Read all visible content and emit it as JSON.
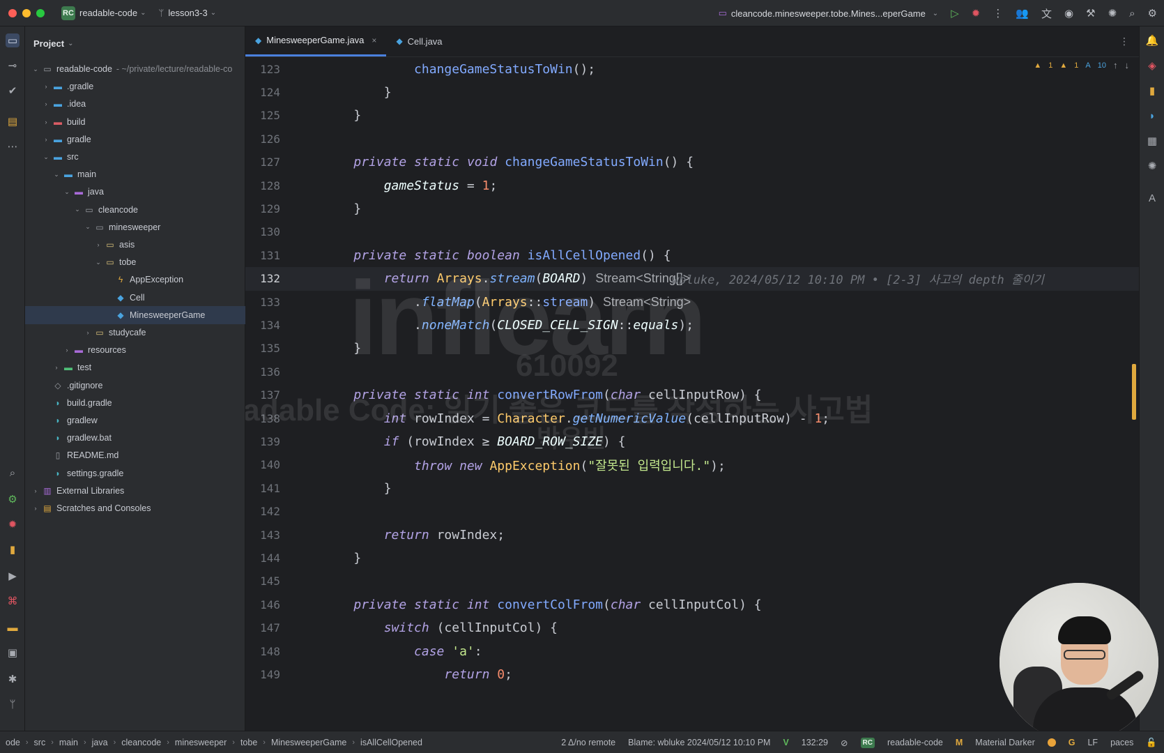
{
  "titlebar": {
    "project_badge": "RC",
    "project_name": "readable-code",
    "branch": "lesson3-3",
    "run_config": "cleancode.minesweeper.tobe.Mines...eperGame"
  },
  "project_panel": {
    "title": "Project",
    "tree": [
      {
        "label": "readable-code",
        "hint": "- ~/private/lecture/readable-co",
        "depth": 0,
        "arrow": "open",
        "icon": "module-folder-icon"
      },
      {
        "label": ".gradle",
        "depth": 1,
        "arrow": "closed",
        "icon": "folder-icon"
      },
      {
        "label": ".idea",
        "depth": 1,
        "arrow": "closed",
        "icon": "folder-icon"
      },
      {
        "label": "build",
        "depth": 1,
        "arrow": "closed",
        "icon": "folder-excluded-icon"
      },
      {
        "label": "gradle",
        "depth": 1,
        "arrow": "closed",
        "icon": "folder-icon"
      },
      {
        "label": "src",
        "depth": 1,
        "arrow": "open",
        "icon": "folder-icon"
      },
      {
        "label": "main",
        "depth": 2,
        "arrow": "open",
        "icon": "folder-icon"
      },
      {
        "label": "java",
        "depth": 3,
        "arrow": "open",
        "icon": "source-folder-icon"
      },
      {
        "label": "cleancode",
        "depth": 4,
        "arrow": "open",
        "icon": "package-icon"
      },
      {
        "label": "minesweeper",
        "depth": 5,
        "arrow": "open",
        "icon": "package-icon"
      },
      {
        "label": "asis",
        "depth": 6,
        "arrow": "closed",
        "icon": "package-icon"
      },
      {
        "label": "tobe",
        "depth": 6,
        "arrow": "open",
        "icon": "package-icon"
      },
      {
        "label": "AppException",
        "depth": 7,
        "arrow": "none",
        "icon": "exception-class-icon"
      },
      {
        "label": "Cell",
        "depth": 7,
        "arrow": "none",
        "icon": "class-icon"
      },
      {
        "label": "MinesweeperGame",
        "depth": 7,
        "arrow": "none",
        "icon": "class-icon",
        "selected": true
      },
      {
        "label": "studycafe",
        "depth": 5,
        "arrow": "closed",
        "icon": "package-icon"
      },
      {
        "label": "resources",
        "depth": 3,
        "arrow": "closed",
        "icon": "resources-folder-icon"
      },
      {
        "label": "test",
        "depth": 2,
        "arrow": "closed",
        "icon": "test-folder-icon"
      },
      {
        "label": ".gitignore",
        "depth": 1,
        "arrow": "none",
        "icon": "gitignore-icon"
      },
      {
        "label": "build.gradle",
        "depth": 1,
        "arrow": "none",
        "icon": "gradle-icon"
      },
      {
        "label": "gradlew",
        "depth": 1,
        "arrow": "none",
        "icon": "gradle-icon"
      },
      {
        "label": "gradlew.bat",
        "depth": 1,
        "arrow": "none",
        "icon": "gradle-icon"
      },
      {
        "label": "README.md",
        "depth": 1,
        "arrow": "none",
        "icon": "markdown-icon"
      },
      {
        "label": "settings.gradle",
        "depth": 1,
        "arrow": "none",
        "icon": "gradle-icon"
      },
      {
        "label": "External Libraries",
        "depth": 0,
        "arrow": "closed",
        "icon": "library-icon"
      },
      {
        "label": "Scratches and Consoles",
        "depth": 0,
        "arrow": "closed",
        "icon": "scratches-icon"
      }
    ]
  },
  "tabs": [
    {
      "label": "MinesweeperGame.java",
      "active": true,
      "closable": true
    },
    {
      "label": "Cell.java",
      "active": false,
      "closable": false
    }
  ],
  "inspections": {
    "warnings_1": "1",
    "warnings_2": "1",
    "typos": "10"
  },
  "editor": {
    "current_line": 132,
    "blame_inline": "wbluke, 2024/05/12 10:10 PM • [2-3] 사고의 depth 줄이기",
    "lines": [
      {
        "n": 123,
        "text": "            changeGameStatusToWin();"
      },
      {
        "n": 124,
        "text": "        }"
      },
      {
        "n": 125,
        "text": "    }"
      },
      {
        "n": 126,
        "text": ""
      },
      {
        "n": 127,
        "text": "    private static void changeGameStatusToWin() {"
      },
      {
        "n": 128,
        "text": "        gameStatus = 1;"
      },
      {
        "n": 129,
        "text": "    }"
      },
      {
        "n": 130,
        "text": ""
      },
      {
        "n": 131,
        "text": "    private static boolean isAllCellOpened() {"
      },
      {
        "n": 132,
        "text": "        return Arrays.stream(BOARD) Stream<String[]>"
      },
      {
        "n": 133,
        "text": "            .flatMap(Arrays::stream) Stream<String>"
      },
      {
        "n": 134,
        "text": "            .noneMatch(CLOSED_CELL_SIGN::equals);"
      },
      {
        "n": 135,
        "text": "    }"
      },
      {
        "n": 136,
        "text": ""
      },
      {
        "n": 137,
        "text": "    private static int convertRowFrom(char cellInputRow) {"
      },
      {
        "n": 138,
        "text": "        int rowIndex = Character.getNumericValue(cellInputRow) - 1;"
      },
      {
        "n": 139,
        "text": "        if (rowIndex ≥ BOARD_ROW_SIZE) {"
      },
      {
        "n": 140,
        "text": "            throw new AppException(\"잘못된 입력입니다.\");"
      },
      {
        "n": 141,
        "text": "        }"
      },
      {
        "n": 142,
        "text": ""
      },
      {
        "n": 143,
        "text": "        return rowIndex;"
      },
      {
        "n": 144,
        "text": "    }"
      },
      {
        "n": 145,
        "text": ""
      },
      {
        "n": 146,
        "text": "    private static int convertColFrom(char cellInputCol) {"
      },
      {
        "n": 147,
        "text": "        switch (cellInputCol) {"
      },
      {
        "n": 148,
        "text": "            case 'a':"
      },
      {
        "n": 149,
        "text": "                return 0;"
      }
    ]
  },
  "watermark": {
    "brand": "inflearn",
    "user_id": "610092",
    "course": "Readable Code: 읽기 좋은 코드를 작성하는 사고법",
    "author": "박우빈"
  },
  "statusbar": {
    "breadcrumbs": [
      "ode",
      "src",
      "main",
      "java",
      "cleancode",
      "minesweeper",
      "tobe",
      "MinesweeperGame",
      "isAllCellOpened"
    ],
    "vcs": "2 Δ/no remote",
    "blame": "Blame: wbluke 2024/05/12 10:10 PM",
    "position": "132:29",
    "project_badge": "RC",
    "project": "readable-code",
    "theme": "Material Darker",
    "line_sep": "LF",
    "indent": "paces"
  }
}
